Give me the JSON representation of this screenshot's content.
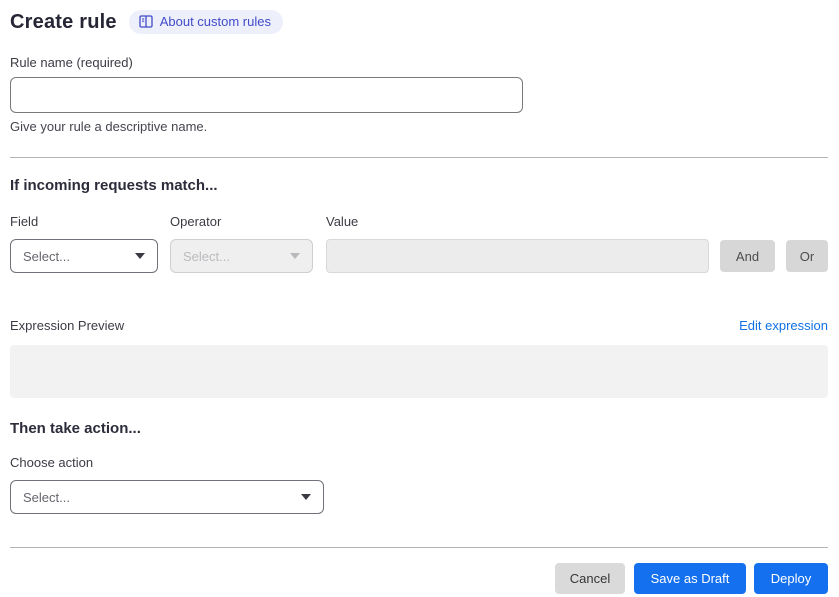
{
  "header": {
    "title": "Create rule",
    "badge": {
      "label": "About custom rules",
      "icon": "book-icon"
    }
  },
  "rule_name": {
    "label": "Rule name (required)",
    "value": "",
    "placeholder": "",
    "helper": "Give your rule a descriptive name."
  },
  "match_section": {
    "heading": "If incoming requests match...",
    "field": {
      "label": "Field",
      "selected": "Select..."
    },
    "operator": {
      "label": "Operator",
      "selected": "Select..."
    },
    "value_input": {
      "label": "Value",
      "value": "",
      "placeholder": ""
    },
    "and_button": "And",
    "or_button": "Or",
    "expression_preview_label": "Expression Preview",
    "edit_expression_link": "Edit expression",
    "expression_value": ""
  },
  "action_section": {
    "heading": "Then take action...",
    "choose_label": "Choose action",
    "selected": "Select..."
  },
  "footer": {
    "cancel_label": "Cancel",
    "save_draft_label": "Save as Draft",
    "deploy_label": "Deploy"
  },
  "colors": {
    "primary_blue": "#1570ef",
    "link_blue": "#1071e5",
    "badge_bg": "#edeffb",
    "badge_text": "#424bc8",
    "disabled_bg": "#ececec",
    "neutral_button_bg": "#d7d7d7",
    "divider": "#b5b5b5"
  }
}
